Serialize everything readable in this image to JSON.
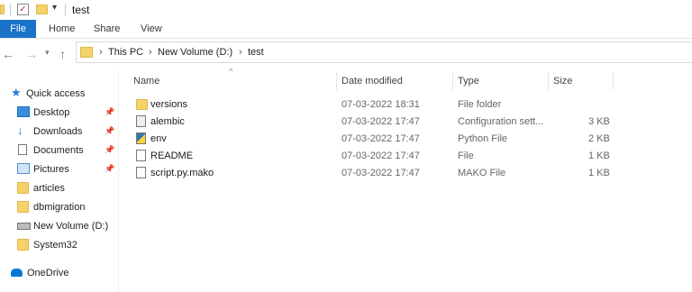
{
  "title": "test",
  "ribbon": {
    "tabs": [
      "File",
      "Home",
      "Share",
      "View"
    ]
  },
  "breadcrumb": [
    "This PC",
    "New Volume (D:)",
    "test"
  ],
  "sidebar": {
    "items": [
      {
        "label": "Quick access",
        "icon": "star-icon",
        "pinned": false
      },
      {
        "label": "Desktop",
        "icon": "desktop-icon",
        "pinned": true
      },
      {
        "label": "Downloads",
        "icon": "download-arrow-icon",
        "pinned": true
      },
      {
        "label": "Documents",
        "icon": "documents-icon",
        "pinned": true
      },
      {
        "label": "Pictures",
        "icon": "pictures-icon",
        "pinned": true
      },
      {
        "label": "articles",
        "icon": "folder-icon",
        "pinned": false
      },
      {
        "label": "dbmigration",
        "icon": "folder-icon",
        "pinned": false
      },
      {
        "label": "New Volume (D:)",
        "icon": "drive-icon",
        "pinned": false
      },
      {
        "label": "System32",
        "icon": "folder-icon",
        "pinned": false
      },
      {
        "label": "OneDrive",
        "icon": "onedrive-icon",
        "pinned": false
      }
    ]
  },
  "columns": {
    "name": "Name",
    "date": "Date modified",
    "type": "Type",
    "size": "Size"
  },
  "files": [
    {
      "name": "versions",
      "date": "07-03-2022 18:31",
      "type": "File folder",
      "size": "",
      "icon": "folder-icon"
    },
    {
      "name": "alembic",
      "date": "07-03-2022 17:47",
      "type": "Configuration sett...",
      "size": "3 KB",
      "icon": "config-file-icon"
    },
    {
      "name": "env",
      "date": "07-03-2022 17:47",
      "type": "Python File",
      "size": "2 KB",
      "icon": "python-file-icon"
    },
    {
      "name": "README",
      "date": "07-03-2022 17:47",
      "type": "File",
      "size": "1 KB",
      "icon": "file-icon"
    },
    {
      "name": "script.py.mako",
      "date": "07-03-2022 17:47",
      "type": "MAKO File",
      "size": "1 KB",
      "icon": "file-icon"
    }
  ],
  "colors": {
    "accent": "#1a73c8",
    "folder": "#f6d26b"
  }
}
